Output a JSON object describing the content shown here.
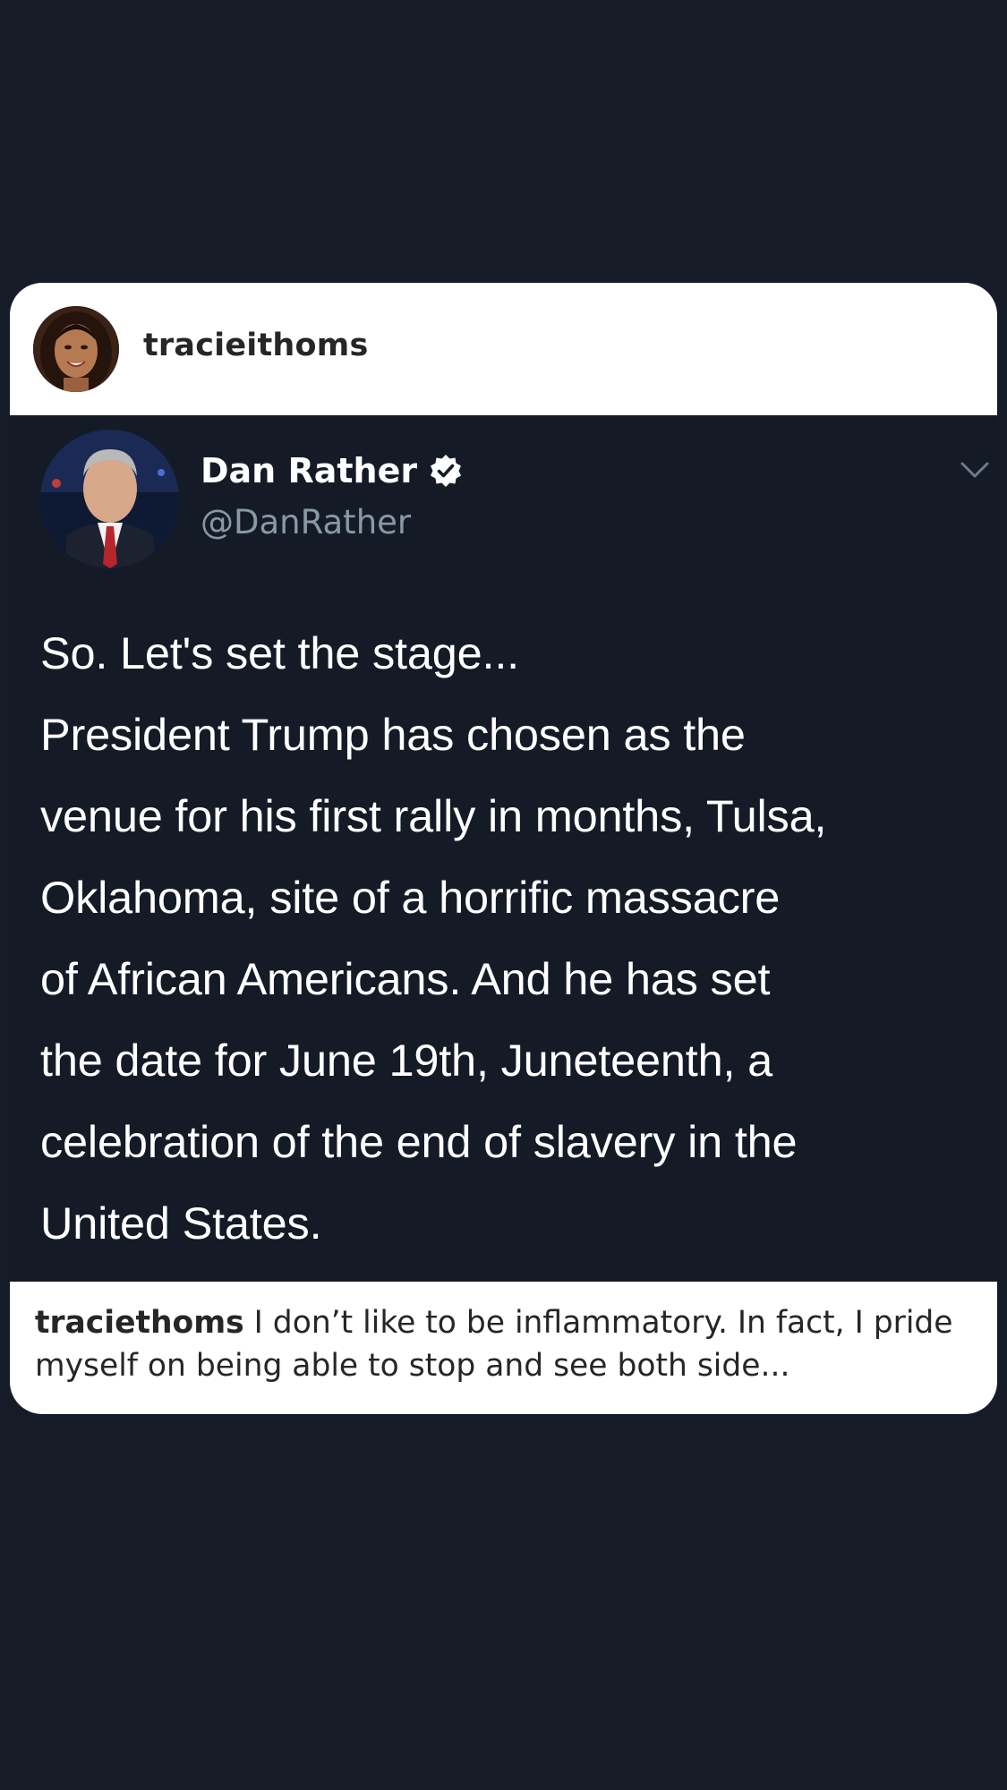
{
  "post": {
    "username": "tracieithoms"
  },
  "tweet": {
    "author_name": "Dan Rather",
    "handle": "@DanRather",
    "verified": true,
    "text": "So. Let's set the stage...\nPresident Trump has chosen as the\nvenue for his first rally in months, Tulsa,\nOklahoma, site of a horrific massacre\nof African Americans. And he has set\nthe date for June 19th, Juneteenth, a\ncelebration of the end of slavery in the\nUnited States."
  },
  "caption": {
    "username": "traciethoms",
    "text": " I don’t like to be inflammatory. In fact, I pride myself on being able to stop and see both side..."
  },
  "icons": {
    "verified": "verified-badge-icon",
    "menu": "chevron-down-icon"
  },
  "colors": {
    "background": "#161c27",
    "card_white": "#ffffff",
    "tweet_text": "#ffffff",
    "handle_gray": "#8899a6"
  }
}
